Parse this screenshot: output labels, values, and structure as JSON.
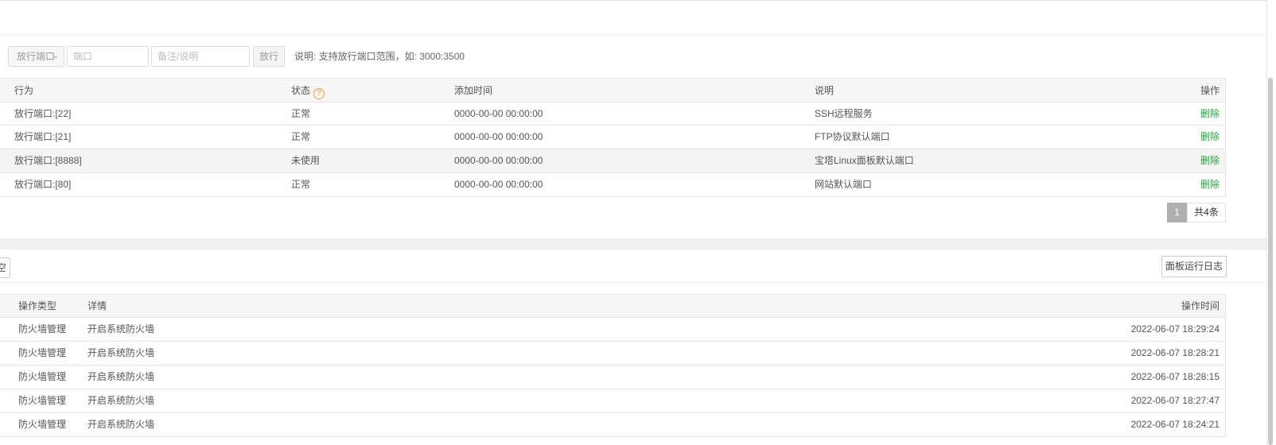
{
  "toolbar": {
    "select_value": "放行端口",
    "port_placeholder": "端口",
    "note_placeholder": "备注/说明",
    "submit_label": "放行",
    "hint": "说明: 支持放行端口范围，如: 3000:3500"
  },
  "rules_table": {
    "headers": {
      "action": "行为",
      "status": "状态",
      "added": "添加时间",
      "desc": "说明",
      "op": "操作"
    },
    "help_glyph": "?",
    "rows": [
      {
        "action": "放行端口:[22]",
        "status": "正常",
        "added": "0000-00-00 00:00:00",
        "desc": "SSH远程服务",
        "op": "删除"
      },
      {
        "action": "放行端口:[21]",
        "status": "正常",
        "added": "0000-00-00 00:00:00",
        "desc": "FTP协议默认端口",
        "op": "删除"
      },
      {
        "action": "放行端口:[8888]",
        "status": "未使用",
        "added": "0000-00-00 00:00:00",
        "desc": "宝塔Linux面板默认端口",
        "op": "删除"
      },
      {
        "action": "放行端口:[80]",
        "status": "正常",
        "added": "0000-00-00 00:00:00",
        "desc": "网站默认端口",
        "op": "删除"
      }
    ],
    "pager": {
      "current": "1",
      "total": "共4条"
    }
  },
  "log_section": {
    "edge_button": "空",
    "log_button": "面板运行日志",
    "headers": {
      "type": "操作类型",
      "detail": "详情",
      "time": "操作时间"
    },
    "rows": [
      {
        "type": "防火墙管理",
        "detail": "开启系统防火墙",
        "time": "2022-06-07 18:29:24"
      },
      {
        "type": "防火墙管理",
        "detail": "开启系统防火墙",
        "time": "2022-06-07 18:28:21"
      },
      {
        "type": "防火墙管理",
        "detail": "开启系统防火墙",
        "time": "2022-06-07 18:28:15"
      },
      {
        "type": "防火墙管理",
        "detail": "开启系统防火墙",
        "time": "2022-06-07 18:27:47"
      },
      {
        "type": "防火墙管理",
        "detail": "开启系统防火墙",
        "time": "2022-06-07 18:24:21"
      }
    ]
  },
  "colors": {
    "accent_green": "#20a53a",
    "help_orange": "#f0a030"
  }
}
